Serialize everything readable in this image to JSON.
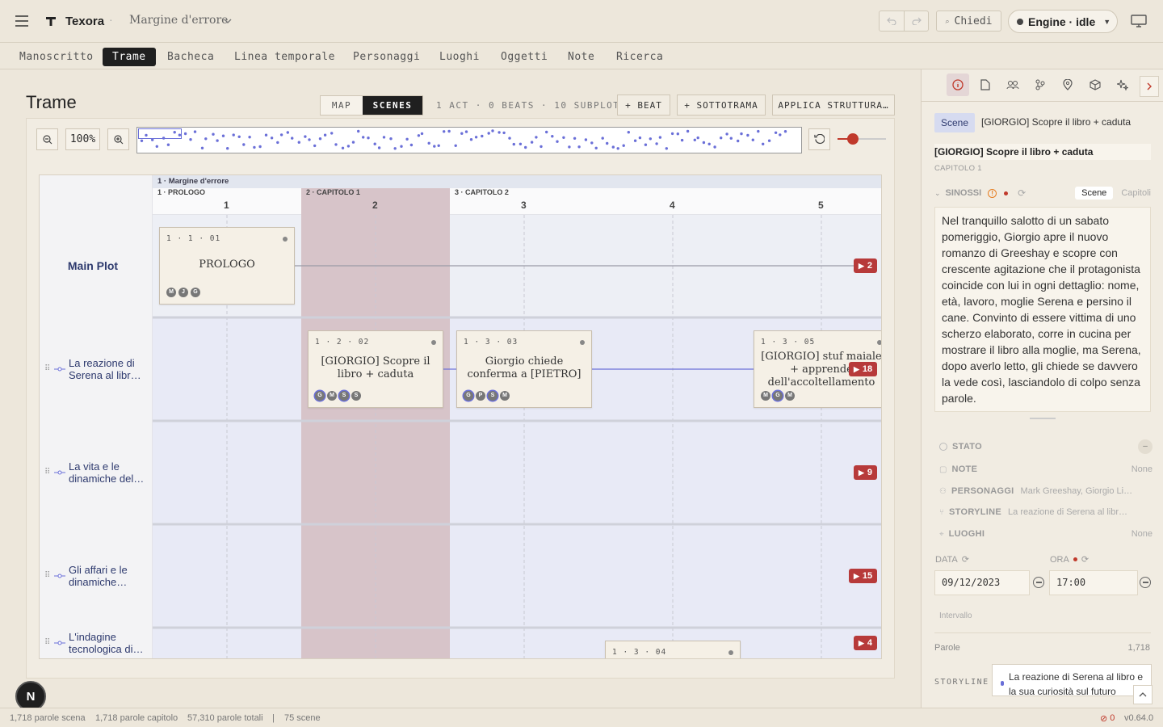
{
  "app": {
    "name": "Texora",
    "project": "Margine d'errore"
  },
  "topbar": {
    "ask_label": "Chiedi",
    "engine_label": "Engine · idle"
  },
  "tabs": [
    {
      "label": "Manoscritto",
      "active": false
    },
    {
      "label": "Trame",
      "active": true
    },
    {
      "label": "Bacheca",
      "active": false
    },
    {
      "label": "Linea temporale",
      "active": false
    },
    {
      "label": "Personaggi",
      "active": false
    },
    {
      "label": "Luoghi",
      "active": false
    },
    {
      "label": "Oggetti",
      "active": false
    },
    {
      "label": "Note",
      "active": false
    },
    {
      "label": "Ricerca",
      "active": false
    }
  ],
  "view": {
    "title": "Trame",
    "toggle": {
      "map": "MAP",
      "scenes": "SCENES",
      "active": "scenes"
    },
    "summary": "1 ACT · 0 BEATS · 10 SUBPLOTS",
    "add_beat": "+ BEAT",
    "add_subplot": "+ SOTTOTRAMA",
    "apply_structure": "APPLICA STRUTTURA…",
    "zoom": "100%",
    "zoom_slider_value": 0.25
  },
  "grid": {
    "act_label": "1 · Margine d'errore",
    "chapters": [
      {
        "label": "1 · PROLOGO"
      },
      {
        "label": "2 · CAPITOLO 1"
      },
      {
        "label": "3 · CAPITOLO 2"
      }
    ],
    "columns": [
      "1",
      "2",
      "3",
      "4",
      "5"
    ],
    "rows": [
      {
        "label": "Main Plot",
        "main": true
      },
      {
        "label": "La reazione di Serena al libr…"
      },
      {
        "label": "La vita e le dinamiche del…"
      },
      {
        "label": "Gli affari e le dinamiche…"
      },
      {
        "label": "L'indagine tecnologica di…"
      }
    ],
    "scenes": [
      {
        "ref": "1 · 1 · 01",
        "title": "PROLOGO",
        "avatars": [
          "M",
          "J",
          "G"
        ]
      },
      {
        "ref": "1 · 2 · 02",
        "title": "[GIORGIO] Scopre il libro + caduta",
        "avatars": [
          "G",
          "M",
          "S",
          "S"
        ]
      },
      {
        "ref": "1 · 3 · 03",
        "title": "Giorgio chiede conferma a [PIETRO]",
        "avatars": [
          "G",
          "P",
          "S",
          "M"
        ]
      },
      {
        "ref": "1 · 3 · 05",
        "title": "[GIORGIO] stuf maiale + apprende dell'accoltellamento",
        "avatars": [
          "M",
          "G",
          "M"
        ]
      },
      {
        "ref": "1 · 3 · 04",
        "title": "",
        "avatars": []
      }
    ],
    "badges": [
      "2",
      "18",
      "9",
      "15",
      "4"
    ]
  },
  "panel": {
    "scene_chip": "Scene",
    "scene_name": "[GIORGIO] Scopre il libro + caduta",
    "title": "[GIORGIO] Scopre il libro + caduta",
    "chapter": "CAPITOLO 1",
    "synopsis_label": "SINOSSI",
    "synopsis_tab_scene": "Scene",
    "synopsis_tab_chapters": "Capitoli",
    "synopsis": "Nel tranquillo salotto di un sabato pomeriggio, Giorgio apre il nuovo romanzo di Greeshay e scopre con crescente agitazione che il protagonista coincide con lui in ogni dettaglio: nome, età, lavoro, moglie Serena e persino il cane. Convinto di essere vittima di uno scherzo elaborato, corre in cucina per mostrare il libro alla moglie, ma Serena, dopo averlo letto, gli chiede se davvero la vede così, lasciandolo di colpo senza parole.",
    "props": {
      "stato": {
        "label": "STATO",
        "value": "–"
      },
      "note": {
        "label": "NOTE",
        "value": "None"
      },
      "personaggi": {
        "label": "PERSONAGGI",
        "value": "Mark Greeshay, Giorgio Li…"
      },
      "storyline": {
        "label": "STORYLINE",
        "value": "La reazione di Serena al libr…"
      },
      "luoghi": {
        "label": "LUOGHI",
        "value": "None"
      }
    },
    "date_label": "DATA",
    "date_value": "09/12/2023",
    "time_label": "ORA",
    "time_value": "17:00",
    "interval_label": "Intervallo",
    "words_label": "Parole",
    "words_value": "1,718",
    "storyline_label": "STORYLINE",
    "storyline_value": "La reazione di Serena al libro e la sua curiosità sul futuro"
  },
  "status": {
    "scene_words": "1,718 parole scena",
    "chapter_words": "1,718 parole capitolo",
    "total_words": "57,310 parole totali",
    "separator": "|",
    "scenes": "75 scene",
    "errors": "0",
    "version": "v0.64.0"
  },
  "colors": {
    "accent": "#6a6fd8",
    "danger": "#b73a3a",
    "active_tab": "#1f1f1f",
    "highlight_column": "#d7c4c9"
  }
}
